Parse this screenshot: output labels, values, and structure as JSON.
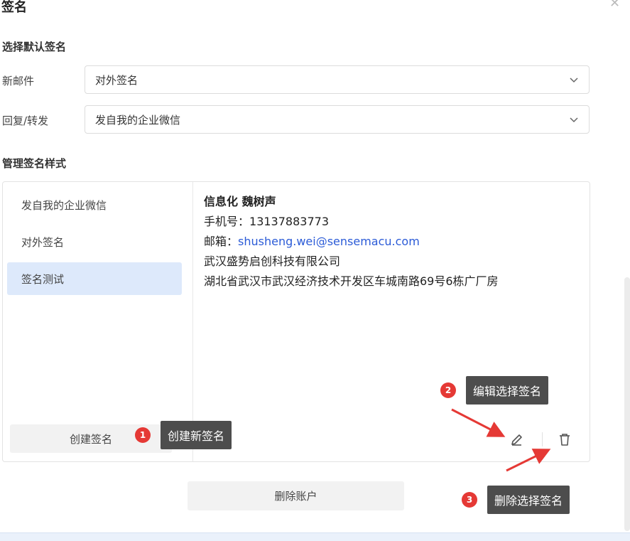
{
  "dialog": {
    "title": "签名"
  },
  "defaults": {
    "heading": "选择默认签名",
    "new_mail": {
      "label": "新邮件",
      "value": "对外签名"
    },
    "reply_forward": {
      "label": "回复/转发",
      "value": "发自我的企业微信"
    }
  },
  "manage": {
    "heading": "管理签名样式",
    "signatures": [
      {
        "label": "发自我的企业微信",
        "selected": false
      },
      {
        "label": "对外签名",
        "selected": false
      },
      {
        "label": "签名测试",
        "selected": true
      }
    ],
    "create_label": "创建签名",
    "preview": {
      "name": "信息化  魏树声",
      "phone_label": "手机号：",
      "phone": "13137883773",
      "email_label": "邮箱：",
      "email": "shusheng.wei@sensemacu.com",
      "company": "武汉盛势启创科技有限公司",
      "address": "湖北省武汉市武汉经济技术开发区车城南路69号6栋广厂房"
    }
  },
  "delete_account_label": "删除账户",
  "annotations": [
    {
      "number": "1",
      "text": "创建新签名"
    },
    {
      "number": "2",
      "text": "编辑选择签名"
    },
    {
      "number": "3",
      "text": "删除选择签名"
    }
  ],
  "colors": {
    "accent_selected": "#dde9fb",
    "link": "#2b5bd7",
    "callout_bg": "#4d4d4d",
    "badge": "#e53935",
    "arrow": "#e53935"
  },
  "icons": {
    "select_chevron": "chevron-down-icon",
    "edit": "pencil-icon",
    "delete": "trash-icon",
    "close": "close-icon"
  }
}
